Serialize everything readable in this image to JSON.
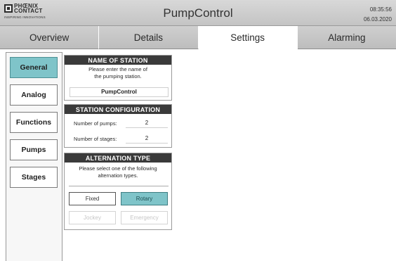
{
  "header": {
    "logo": {
      "line1": "PHŒNIX",
      "line2": "CONTACT",
      "tagline": "INSPIRING INNOVATIONS"
    },
    "title": "PumpControl",
    "time": "08:35:56",
    "date": "06.03.2020"
  },
  "nav": {
    "tabs": [
      {
        "label": "Overview",
        "active": false
      },
      {
        "label": "Details",
        "active": false
      },
      {
        "label": "Settings",
        "active": true
      },
      {
        "label": "Alarming",
        "active": false
      }
    ]
  },
  "sidebar": {
    "items": [
      {
        "label": "General",
        "active": true
      },
      {
        "label": "Analog",
        "active": false
      },
      {
        "label": "Functions",
        "active": false
      },
      {
        "label": "Pumps",
        "active": false
      },
      {
        "label": "Stages",
        "active": false
      }
    ]
  },
  "station_name": {
    "heading": "NAME OF STATION",
    "instruction_line1": "Please enter the name of",
    "instruction_line2": "the pumping station.",
    "value": "PumpControl"
  },
  "station_config": {
    "heading": "STATION CONFIGURATION",
    "pumps_label": "Number of pumps:",
    "pumps_value": "2",
    "stages_label": "Number of stages:",
    "stages_value": "2"
  },
  "alternation": {
    "heading": "ALTERNATION TYPE",
    "instruction_line1": "Please select one of the following",
    "instruction_line2": "alternation types.",
    "options": [
      {
        "label": "Fixed",
        "state": "normal"
      },
      {
        "label": "Rotary",
        "state": "selected"
      },
      {
        "label": "Jockey",
        "state": "disabled"
      },
      {
        "label": "Emergency",
        "state": "disabled"
      }
    ]
  },
  "colors": {
    "accent": "#7fc4c9",
    "panel_header": "#3a3a3a",
    "header_bg": "#cfcfcf"
  }
}
